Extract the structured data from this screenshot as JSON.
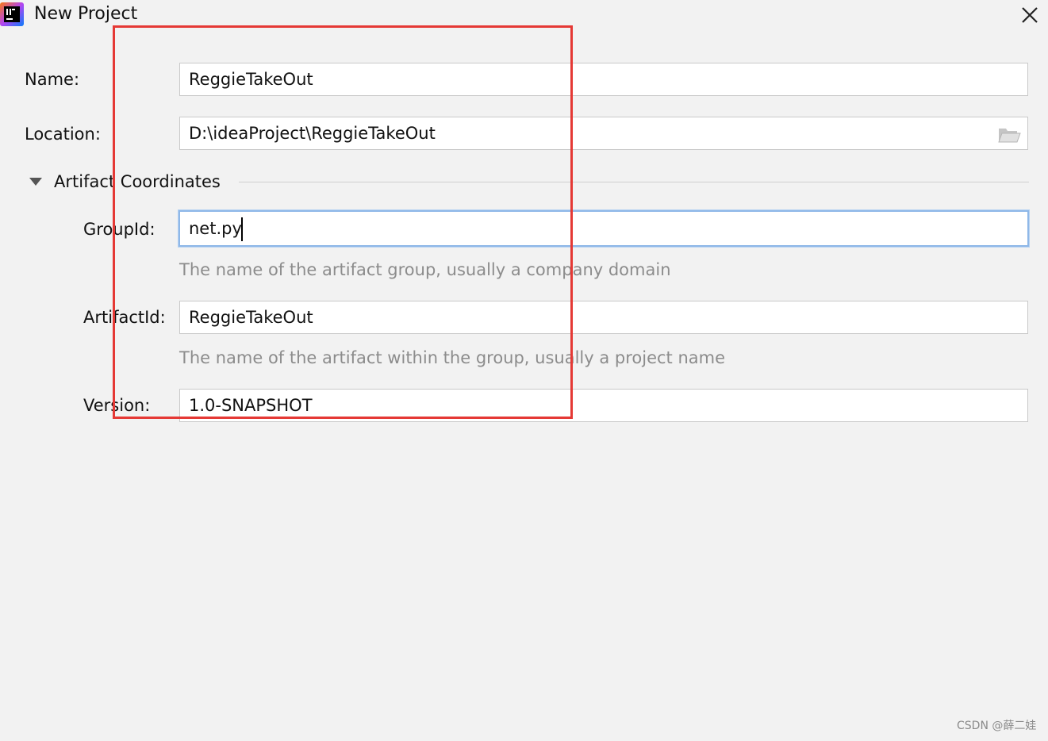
{
  "window": {
    "title": "New Project",
    "icon": "intellij-idea-icon",
    "close_icon": "close-icon"
  },
  "form": {
    "name": {
      "label": "Name:",
      "value": "ReggieTakeOut"
    },
    "location": {
      "label": "Location:",
      "value": "D:\\ideaProject\\ReggieTakeOut",
      "browse_icon": "folder-icon"
    },
    "artifact_section": {
      "title": "Artifact Coordinates",
      "expanded": true,
      "toggle_icon": "triangle-down-icon"
    },
    "group_id": {
      "label": "GroupId:",
      "value": "net.py",
      "hint": "The name of the artifact group, usually a company domain",
      "focused": true
    },
    "artifact_id": {
      "label": "ArtifactId:",
      "value": "ReggieTakeOut",
      "hint": "The name of the artifact within the group, usually a project name"
    },
    "version": {
      "label": "Version:",
      "value": "1.0-SNAPSHOT"
    }
  },
  "annotation": {
    "color": "#e53935"
  },
  "watermark": "CSDN @薛二娃"
}
